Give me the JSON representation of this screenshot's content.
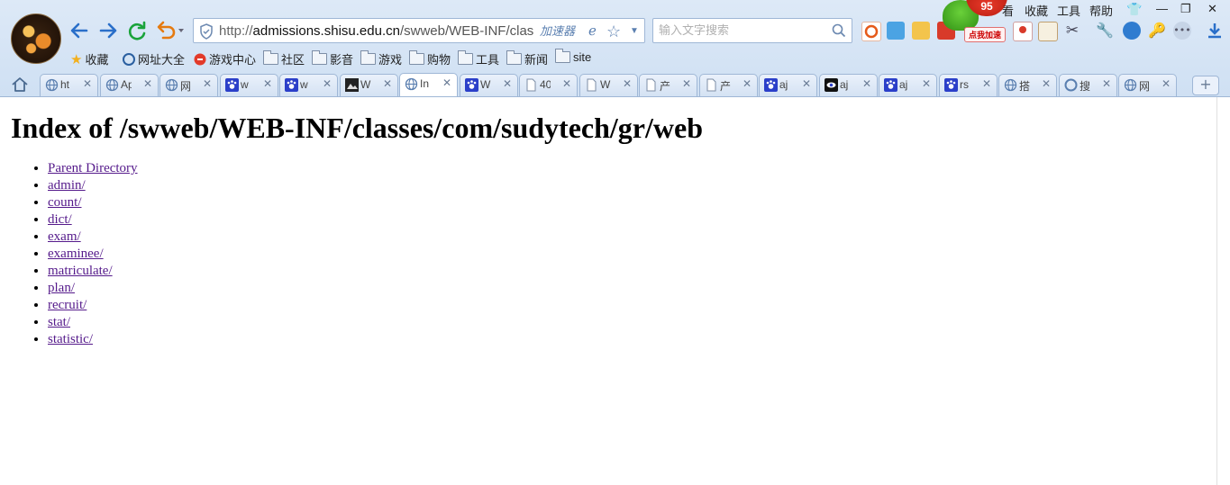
{
  "browser": {
    "address_bar": {
      "scheme": "http://",
      "host": "admissions.shisu.edu.cn",
      "path": "/swweb/WEB-INF/clas",
      "accelerator_label": "加速器"
    },
    "search_box": {
      "placeholder": "输入文字搜索"
    },
    "top_menu": [
      "看",
      "收藏",
      "工具",
      "帮助"
    ],
    "badge_count": "95",
    "speedup_label": "点我加速",
    "bookmarks": [
      {
        "label": "收藏",
        "icon": "star-icon"
      },
      {
        "label": "网址大全",
        "icon": "sogou-icon"
      },
      {
        "label": "游戏中心",
        "icon": "game-center-icon"
      },
      {
        "label": "社区",
        "icon": "folder-icon"
      },
      {
        "label": "影音",
        "icon": "folder-icon"
      },
      {
        "label": "游戏",
        "icon": "folder-icon"
      },
      {
        "label": "购物",
        "icon": "folder-icon"
      },
      {
        "label": "工具",
        "icon": "folder-icon"
      },
      {
        "label": "新闻",
        "icon": "folder-icon"
      },
      {
        "label": "site",
        "icon": "folder-icon"
      }
    ],
    "tabs": [
      {
        "label": "ht",
        "icon": "globe-icon",
        "active": false
      },
      {
        "label": "Ap",
        "icon": "globe-icon",
        "active": false
      },
      {
        "label": "网",
        "icon": "globe-icon",
        "active": false
      },
      {
        "label": "w",
        "icon": "paw-icon",
        "active": false
      },
      {
        "label": "w",
        "icon": "paw-icon",
        "active": false
      },
      {
        "label": "W",
        "icon": "dark-image-icon",
        "active": false
      },
      {
        "label": "In",
        "icon": "globe-icon",
        "active": true
      },
      {
        "label": "W",
        "icon": "paw-icon",
        "active": false
      },
      {
        "label": "40",
        "icon": "page-icon",
        "active": false
      },
      {
        "label": "W",
        "icon": "page-icon",
        "active": false
      },
      {
        "label": "产",
        "icon": "page-icon",
        "active": false
      },
      {
        "label": "产",
        "icon": "page-icon",
        "active": false
      },
      {
        "label": "aj",
        "icon": "paw-icon",
        "active": false
      },
      {
        "label": "aj",
        "icon": "eye-icon",
        "active": false
      },
      {
        "label": "aj",
        "icon": "paw-icon",
        "active": false
      },
      {
        "label": "rs",
        "icon": "paw-icon",
        "active": false
      },
      {
        "label": "搭",
        "icon": "globe-icon",
        "active": false
      },
      {
        "label": "搜",
        "icon": "sogou-icon",
        "active": false
      },
      {
        "label": "网",
        "icon": "globe-icon",
        "active": false
      }
    ]
  },
  "page": {
    "title": "Index of /swweb/WEB-INF/classes/com/sudytech/gr/web",
    "entries": [
      "Parent Directory",
      "admin/",
      "count/",
      "dict/",
      "exam/",
      "examinee/",
      "matriculate/",
      "plan/",
      "recruit/",
      "stat/",
      "statistic/"
    ]
  },
  "colors": {
    "chrome_bg": "#d6e4f5",
    "visited_link": "#551a8b",
    "nav_arrow": "#2a6fc9",
    "refresh": "#1aa33a",
    "undo": "#e57a10"
  }
}
